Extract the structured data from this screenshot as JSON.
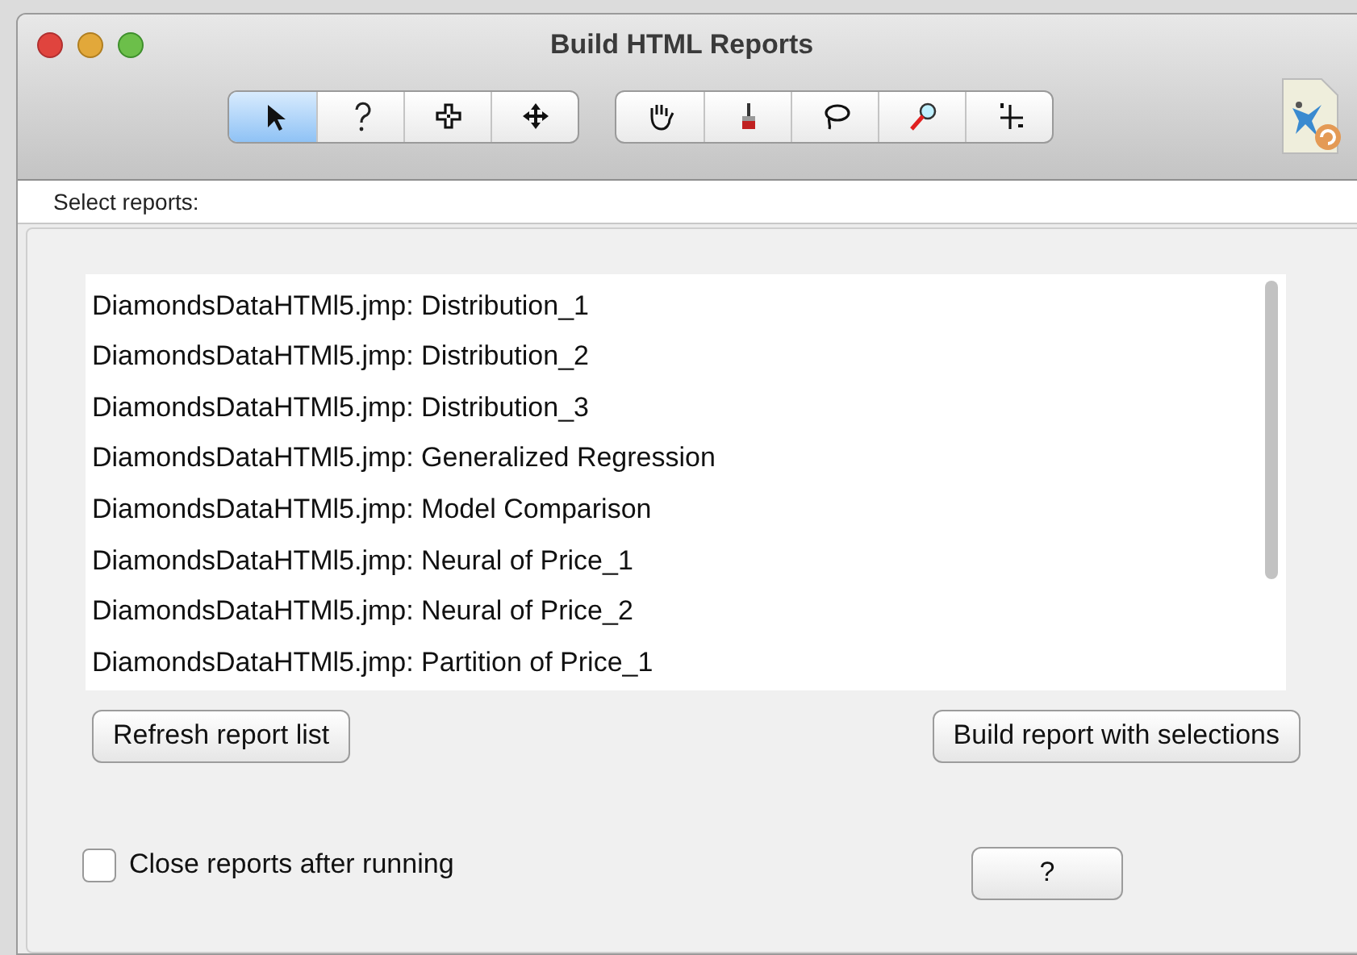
{
  "window": {
    "title": "Build HTML Reports"
  },
  "toolbar": {
    "groups": [
      [
        {
          "kind": "arrow",
          "selected": true
        },
        {
          "kind": "question",
          "selected": false
        },
        {
          "kind": "crosshair",
          "selected": false
        },
        {
          "kind": "move",
          "selected": false
        }
      ],
      [
        {
          "kind": "hand",
          "selected": false
        },
        {
          "kind": "brush",
          "selected": false
        },
        {
          "kind": "lasso",
          "selected": false
        },
        {
          "kind": "magnifier",
          "selected": false
        },
        {
          "kind": "axes",
          "selected": false
        }
      ]
    ]
  },
  "section_label": "Select reports:",
  "reports": [
    {
      "label": "DiamondsDataHTMl5.jmp: Distribution_1",
      "selected": false
    },
    {
      "label": "DiamondsDataHTMl5.jmp: Distribution_2",
      "selected": false
    },
    {
      "label": "DiamondsDataHTMl5.jmp: Distribution_3",
      "selected": false
    },
    {
      "label": "DiamondsDataHTMl5.jmp: Generalized Regression",
      "selected": false
    },
    {
      "label": "DiamondsDataHTMl5.jmp: Model Comparison",
      "selected": false
    },
    {
      "label": "DiamondsDataHTMl5.jmp: Neural of Price_1",
      "selected": false
    },
    {
      "label": "DiamondsDataHTMl5.jmp: Neural of Price_2",
      "selected": false
    },
    {
      "label": "DiamondsDataHTMl5.jmp: Partition of Price_1",
      "selected": false
    }
  ],
  "buttons": {
    "refresh": "Refresh report list",
    "build": "Build report with selections",
    "help": "?"
  },
  "close_reports": {
    "label": "Close reports after running",
    "checked": false
  }
}
